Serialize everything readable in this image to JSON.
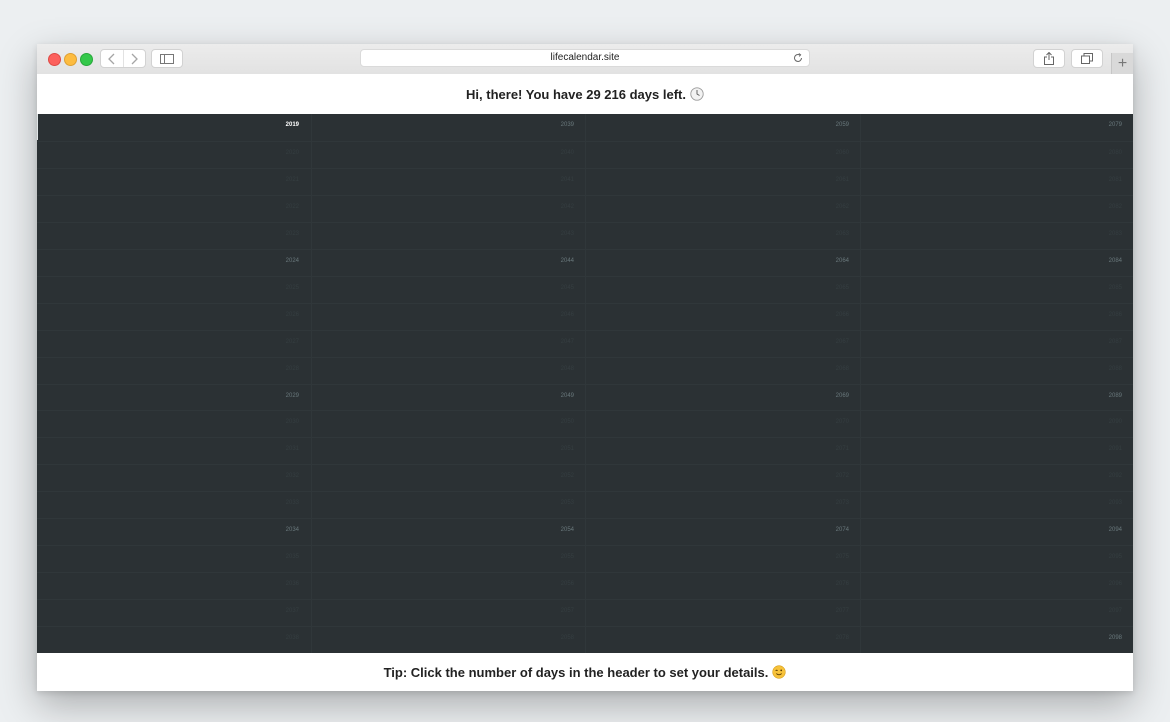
{
  "browser": {
    "url": "lifecalendar.site"
  },
  "header": {
    "greeting": "Hi, there! You have",
    "days_left": "29 216",
    "suffix": "days left.",
    "icon": "clock-icon"
  },
  "calendar": {
    "columns": [
      [
        {
          "year": "2019",
          "state": "current"
        },
        {
          "year": "2020",
          "state": "dim"
        },
        {
          "year": "2021",
          "state": "dim"
        },
        {
          "year": "2022",
          "state": "dim"
        },
        {
          "year": "2023",
          "state": "dim"
        },
        {
          "year": "2024",
          "state": "visible"
        },
        {
          "year": "2025",
          "state": "dim"
        },
        {
          "year": "2026",
          "state": "dim"
        },
        {
          "year": "2027",
          "state": "dim"
        },
        {
          "year": "2028",
          "state": "dim"
        },
        {
          "year": "2029",
          "state": "visible"
        },
        {
          "year": "2030",
          "state": "dim"
        },
        {
          "year": "2031",
          "state": "dim"
        },
        {
          "year": "2032",
          "state": "dim"
        },
        {
          "year": "2033",
          "state": "dim"
        },
        {
          "year": "2034",
          "state": "visible"
        },
        {
          "year": "2035",
          "state": "dim"
        },
        {
          "year": "2036",
          "state": "dim"
        },
        {
          "year": "2037",
          "state": "dim"
        },
        {
          "year": "2038",
          "state": "dim"
        }
      ],
      [
        {
          "year": "2039",
          "state": "visible"
        },
        {
          "year": "2040",
          "state": "dim"
        },
        {
          "year": "2041",
          "state": "dim"
        },
        {
          "year": "2042",
          "state": "dim"
        },
        {
          "year": "2043",
          "state": "dim"
        },
        {
          "year": "2044",
          "state": "visible"
        },
        {
          "year": "2045",
          "state": "dim"
        },
        {
          "year": "2046",
          "state": "dim"
        },
        {
          "year": "2047",
          "state": "dim"
        },
        {
          "year": "2048",
          "state": "dim"
        },
        {
          "year": "2049",
          "state": "visible"
        },
        {
          "year": "2050",
          "state": "dim"
        },
        {
          "year": "2051",
          "state": "dim"
        },
        {
          "year": "2052",
          "state": "dim"
        },
        {
          "year": "2053",
          "state": "dim"
        },
        {
          "year": "2054",
          "state": "visible"
        },
        {
          "year": "2055",
          "state": "dim"
        },
        {
          "year": "2056",
          "state": "dim"
        },
        {
          "year": "2057",
          "state": "dim"
        },
        {
          "year": "2058",
          "state": "dim"
        }
      ],
      [
        {
          "year": "2059",
          "state": "visible"
        },
        {
          "year": "2060",
          "state": "dim"
        },
        {
          "year": "2061",
          "state": "dim"
        },
        {
          "year": "2062",
          "state": "dim"
        },
        {
          "year": "2063",
          "state": "dim"
        },
        {
          "year": "2064",
          "state": "visible"
        },
        {
          "year": "2065",
          "state": "dim"
        },
        {
          "year": "2066",
          "state": "dim"
        },
        {
          "year": "2067",
          "state": "dim"
        },
        {
          "year": "2068",
          "state": "dim"
        },
        {
          "year": "2069",
          "state": "visible"
        },
        {
          "year": "2070",
          "state": "dim"
        },
        {
          "year": "2071",
          "state": "dim"
        },
        {
          "year": "2072",
          "state": "dim"
        },
        {
          "year": "2073",
          "state": "dim"
        },
        {
          "year": "2074",
          "state": "visible"
        },
        {
          "year": "2075",
          "state": "dim"
        },
        {
          "year": "2076",
          "state": "dim"
        },
        {
          "year": "2077",
          "state": "dim"
        },
        {
          "year": "2078",
          "state": "dim"
        }
      ],
      [
        {
          "year": "2079",
          "state": "visible"
        },
        {
          "year": "2080",
          "state": "dim"
        },
        {
          "year": "2081",
          "state": "dim"
        },
        {
          "year": "2082",
          "state": "dim"
        },
        {
          "year": "2083",
          "state": "dim"
        },
        {
          "year": "2084",
          "state": "visible"
        },
        {
          "year": "2085",
          "state": "dim"
        },
        {
          "year": "2086",
          "state": "dim"
        },
        {
          "year": "2087",
          "state": "dim"
        },
        {
          "year": "2088",
          "state": "dim"
        },
        {
          "year": "2089",
          "state": "visible"
        },
        {
          "year": "2090",
          "state": "dim"
        },
        {
          "year": "2091",
          "state": "dim"
        },
        {
          "year": "2092",
          "state": "dim"
        },
        {
          "year": "2093",
          "state": "dim"
        },
        {
          "year": "2094",
          "state": "visible"
        },
        {
          "year": "2095",
          "state": "dim"
        },
        {
          "year": "2096",
          "state": "dim"
        },
        {
          "year": "2097",
          "state": "dim"
        },
        {
          "year": "2098",
          "state": "visible"
        }
      ]
    ]
  },
  "footer": {
    "tip": "Tip: Click the number of days in the header to set your details.",
    "icon": "wink-emoji-icon"
  },
  "colors": {
    "calendar_bg": "#2b3134",
    "year_label": "#69787c",
    "current_year": "#ffffff"
  }
}
